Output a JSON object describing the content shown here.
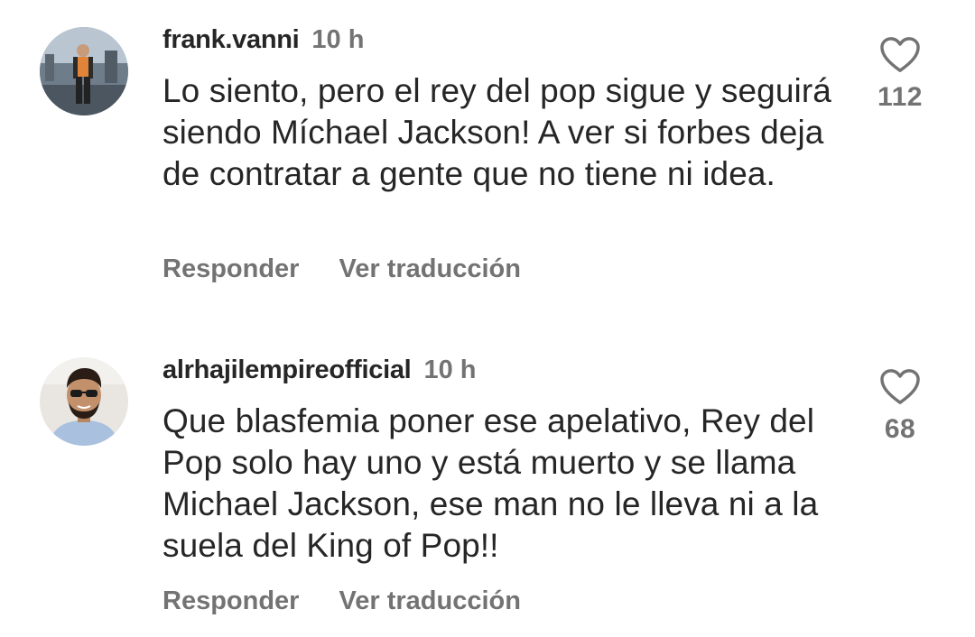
{
  "comments": [
    {
      "username": "frank.vanni",
      "time": "10 h",
      "text": "Lo siento, pero el rey del pop sigue y seguirá siendo Míchael Jackson! A ver si forbes deja de contratar a gente que no tiene ni idea.",
      "likes": "112",
      "reply_label": "Responder",
      "translate_label": "Ver traducción",
      "avatar_icon": "avatar-photo-icon"
    },
    {
      "username": "alrhajilempireofficial",
      "time": "10 h",
      "text": "Que blasfemia poner ese apelativo, Rey del Pop solo hay uno y está muerto y se llama Michael Jackson, ese man no le lleva ni a la suela del King of Pop!!",
      "likes": "68",
      "reply_label": "Responder",
      "translate_label": "Ver traducción",
      "avatar_icon": "avatar-photo-icon"
    }
  ],
  "colors": {
    "primary_text": "#262626",
    "secondary_text": "#737373",
    "heart_outline": "#737373",
    "background": "#ffffff"
  },
  "icons": {
    "like": "heart-outline-icon"
  }
}
